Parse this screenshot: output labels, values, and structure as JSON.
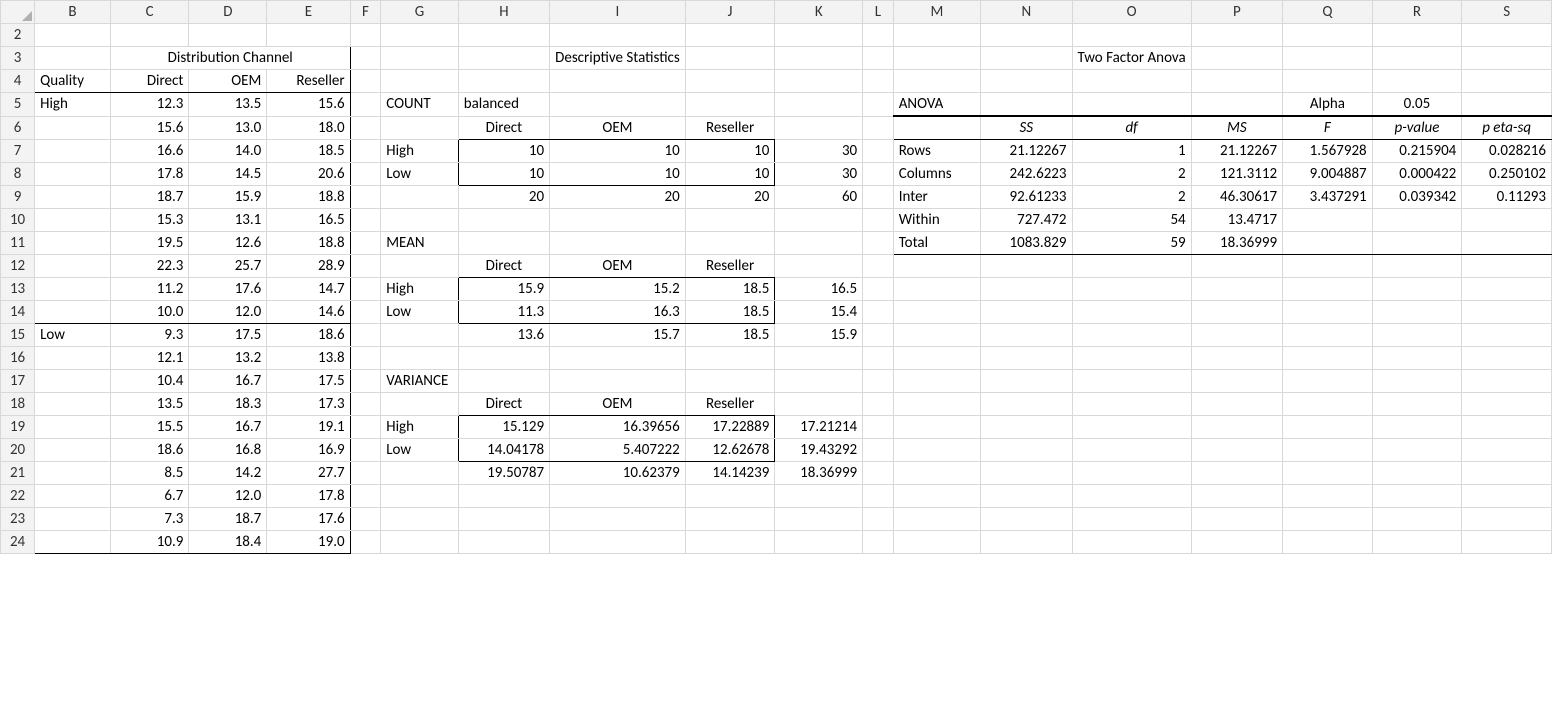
{
  "columns": [
    "B",
    "C",
    "D",
    "E",
    "F",
    "G",
    "H",
    "I",
    "J",
    "K",
    "L",
    "M",
    "N",
    "O",
    "P",
    "Q",
    "R",
    "S"
  ],
  "col_widths": {
    "_row": 35,
    "B": 78,
    "C": 82,
    "D": 82,
    "E": 86,
    "F": 32,
    "G": 78,
    "H": 94,
    "I": 90,
    "J": 92,
    "K": 90,
    "L": 32,
    "M": 90,
    "N": 94,
    "O": 46,
    "P": 94,
    "Q": 92,
    "R": 92,
    "S": 92
  },
  "rows": [
    "2",
    "3",
    "4",
    "5",
    "6",
    "7",
    "8",
    "9",
    "10",
    "11",
    "12",
    "13",
    "14",
    "15",
    "16",
    "17",
    "18",
    "19",
    "20",
    "21",
    "22",
    "23",
    "24"
  ],
  "dist_header": "Distribution Channel",
  "quality_label": "Quality",
  "direct": "Direct",
  "oem": "OEM",
  "reseller": "Reseller",
  "high": "High",
  "low": "Low",
  "data_rows": [
    {
      "q": "High",
      "c": "12.3",
      "d": "13.5",
      "e": "15.6"
    },
    {
      "q": "",
      "c": "15.6",
      "d": "13.0",
      "e": "18.0"
    },
    {
      "q": "",
      "c": "16.6",
      "d": "14.0",
      "e": "18.5"
    },
    {
      "q": "",
      "c": "17.8",
      "d": "14.5",
      "e": "20.6"
    },
    {
      "q": "",
      "c": "18.7",
      "d": "15.9",
      "e": "18.8"
    },
    {
      "q": "",
      "c": "15.3",
      "d": "13.1",
      "e": "16.5"
    },
    {
      "q": "",
      "c": "19.5",
      "d": "12.6",
      "e": "18.8"
    },
    {
      "q": "",
      "c": "22.3",
      "d": "25.7",
      "e": "28.9"
    },
    {
      "q": "",
      "c": "11.2",
      "d": "17.6",
      "e": "14.7"
    },
    {
      "q": "",
      "c": "10.0",
      "d": "12.0",
      "e": "14.6"
    },
    {
      "q": "Low",
      "c": "9.3",
      "d": "17.5",
      "e": "18.6"
    },
    {
      "q": "",
      "c": "12.1",
      "d": "13.2",
      "e": "13.8"
    },
    {
      "q": "",
      "c": "10.4",
      "d": "16.7",
      "e": "17.5"
    },
    {
      "q": "",
      "c": "13.5",
      "d": "18.3",
      "e": "17.3"
    },
    {
      "q": "",
      "c": "15.5",
      "d": "16.7",
      "e": "19.1"
    },
    {
      "q": "",
      "c": "18.6",
      "d": "16.8",
      "e": "16.9"
    },
    {
      "q": "",
      "c": "8.5",
      "d": "14.2",
      "e": "27.7"
    },
    {
      "q": "",
      "c": "6.7",
      "d": "12.0",
      "e": "17.8"
    },
    {
      "q": "",
      "c": "7.3",
      "d": "18.7",
      "e": "17.6"
    },
    {
      "q": "",
      "c": "10.9",
      "d": "18.4",
      "e": "19.0"
    }
  ],
  "desc_title": "Descriptive Statistics",
  "count_label": "COUNT",
  "balanced": "balanced",
  "count": {
    "high": {
      "d": "10",
      "o": "10",
      "r": "10",
      "tot": "30"
    },
    "low": {
      "d": "10",
      "o": "10",
      "r": "10",
      "tot": "30"
    },
    "totals": {
      "d": "20",
      "o": "20",
      "r": "20",
      "tot": "60"
    }
  },
  "mean_label": "MEAN",
  "mean": {
    "high": {
      "d": "15.9",
      "o": "15.2",
      "r": "18.5",
      "tot": "16.5"
    },
    "low": {
      "d": "11.3",
      "o": "16.3",
      "r": "18.5",
      "tot": "15.4"
    },
    "totals": {
      "d": "13.6",
      "o": "15.7",
      "r": "18.5",
      "tot": "15.9"
    }
  },
  "var_label": "VARIANCE",
  "variance": {
    "high": {
      "d": "15.129",
      "o": "16.39656",
      "r": "17.22889",
      "tot": "17.21214"
    },
    "low": {
      "d": "14.04178",
      "o": "5.407222",
      "r": "12.62678",
      "tot": "19.43292"
    },
    "totals": {
      "d": "19.50787",
      "o": "10.62379",
      "r": "14.14239",
      "tot": "18.36999"
    }
  },
  "anova_title": "Two Factor Anova",
  "anova_label": "ANOVA",
  "alpha_label": "Alpha",
  "alpha_value": "0.05",
  "anova_headers": {
    "ss": "SS",
    "df": "df",
    "ms": "MS",
    "f": "F",
    "p": "p-value",
    "eta": "p eta-sq"
  },
  "anova_rows": [
    {
      "name": "Rows",
      "ss": "21.12267",
      "df": "1",
      "ms": "21.12267",
      "f": "1.567928",
      "p": "0.215904",
      "eta": "0.028216"
    },
    {
      "name": "Columns",
      "ss": "242.6223",
      "df": "2",
      "ms": "121.3112",
      "f": "9.004887",
      "p": "0.000422",
      "eta": "0.250102"
    },
    {
      "name": "Inter",
      "ss": "92.61233",
      "df": "2",
      "ms": "46.30617",
      "f": "3.437291",
      "p": "0.039342",
      "eta": "0.11293"
    },
    {
      "name": "Within",
      "ss": "727.472",
      "df": "54",
      "ms": "13.4717",
      "f": "",
      "p": "",
      "eta": ""
    },
    {
      "name": "Total",
      "ss": "1083.829",
      "df": "59",
      "ms": "18.36999",
      "f": "",
      "p": "",
      "eta": ""
    }
  ]
}
